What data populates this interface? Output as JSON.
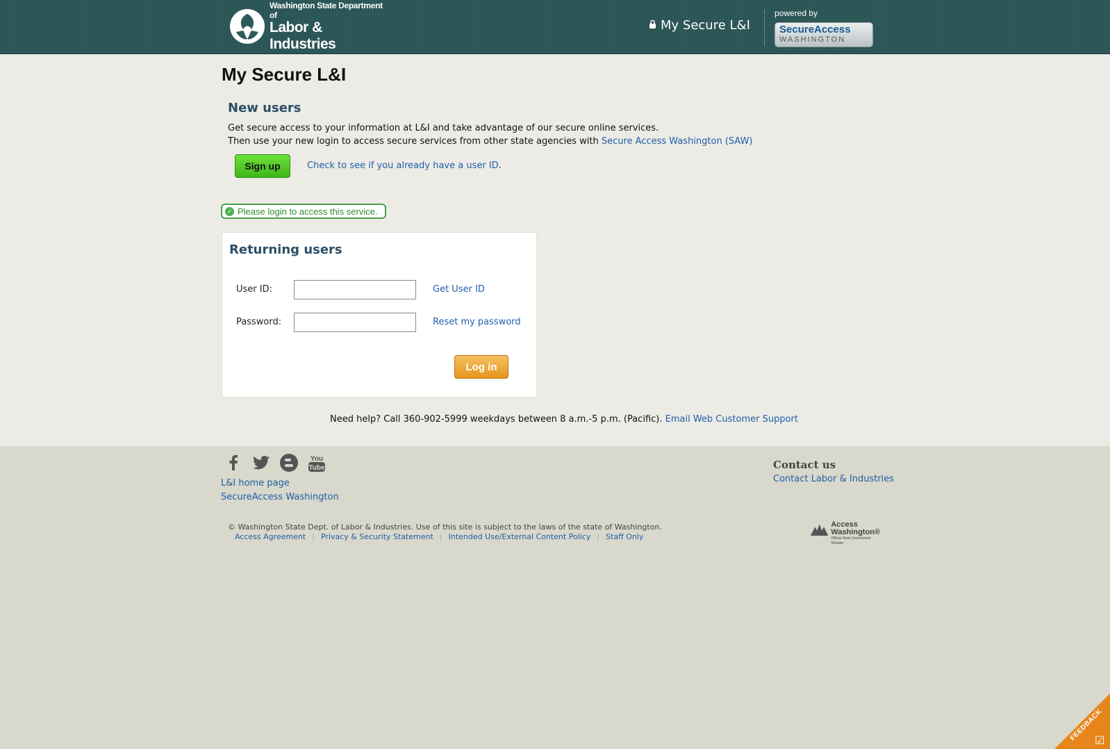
{
  "header": {
    "logo_small": "Washington State Department of",
    "logo_big": "Labor & Industries",
    "my_secure": "My Secure L&I",
    "powered_by": "powered by",
    "saw_line1": "SecureAccess",
    "saw_line2": "WASHINGTON"
  },
  "main": {
    "title": "My Secure L&I",
    "new_users": {
      "heading": "New users",
      "line1": "Get secure access to your information at L&I and take advantage of our secure online services.",
      "line2_prefix": "Then use your new login to access secure services from other state agencies with ",
      "line2_link": "Secure Access Washington (SAW)",
      "signup_label": "Sign up",
      "check_link": "Check to see if you already have a user ID",
      "check_suffix": "."
    },
    "notice": "Please login to access this service.",
    "returning": {
      "heading": "Returning users",
      "userid_label": "User ID:",
      "userid_value": "",
      "password_label": "Password:",
      "password_value": "",
      "get_userid_link": "Get User ID",
      "reset_password_link": "Reset my password",
      "login_label": "Log in"
    },
    "help_text": "Need help? Call 360-902-5999 weekdays between 8 a.m.-5 p.m. (Pacific). ",
    "help_link": "Email Web Customer Support"
  },
  "footer": {
    "social": {
      "facebook": "f",
      "twitter": "t",
      "blogger": "B",
      "youtube": "You Tube"
    },
    "home_link": "L&I home page",
    "saw_link": "SecureAccess Washington",
    "contact_heading": "Contact us",
    "contact_link": "Contact Labor & Industries",
    "copyright": "© Washington State Dept. of Labor & Industries. Use of this site is subject to the laws of the state of Washington.",
    "links": [
      "Access Agreement",
      "Privacy & Security Statement",
      "Intended Use/External Content Policy",
      "Staff Only"
    ],
    "aw_line1": "Access",
    "aw_line2": "Washington®",
    "aw_line3": "Official State Government Website"
  },
  "feedback": "FEEDBACK",
  "colors": {
    "header_bg": "#2f5a5b",
    "link": "#1f5ea8",
    "signup_green": "#4fc41f",
    "login_orange": "#f0a736",
    "notice_green": "#4aa04a"
  },
  "icons": [
    "lock-icon",
    "facebook-icon",
    "twitter-icon",
    "blogger-icon",
    "youtube-icon",
    "check-circle-icon",
    "checkbox-icon"
  ]
}
